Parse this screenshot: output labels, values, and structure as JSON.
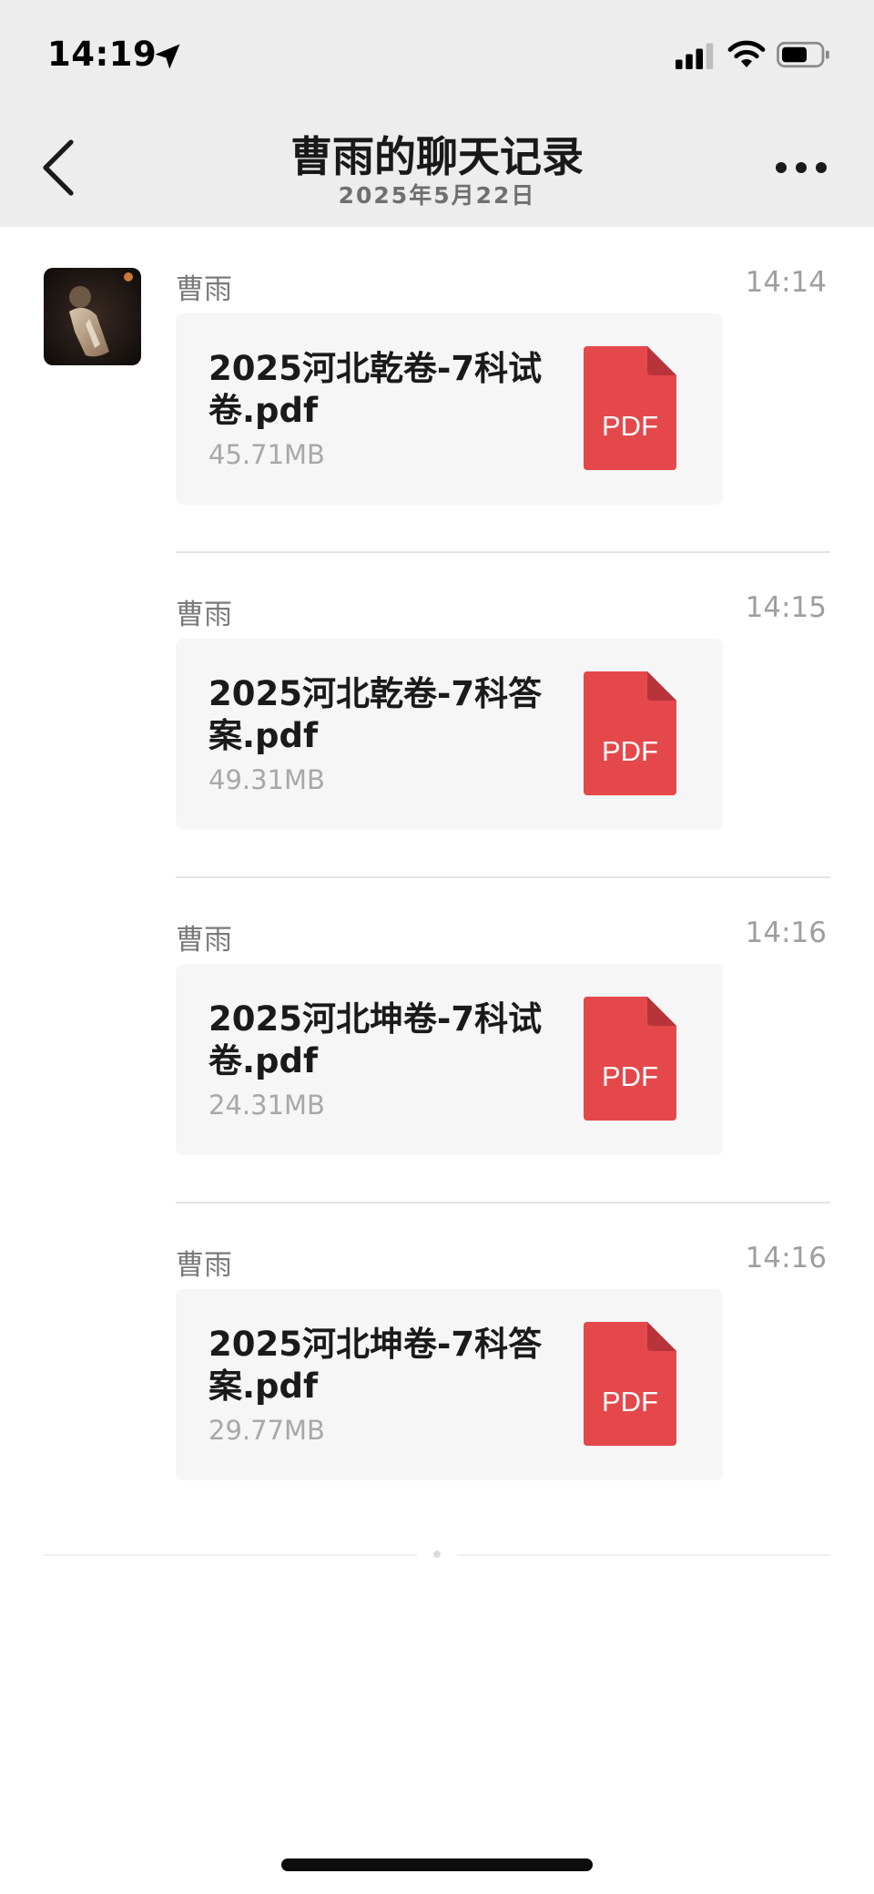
{
  "status_bar": {
    "time": "14:19",
    "icons": [
      "location-arrow-icon",
      "cellular-signal-icon",
      "wifi-icon",
      "battery-icon"
    ]
  },
  "nav": {
    "back_icon": "chevron-left-icon",
    "title": "曹雨的聊天记录",
    "subtitle": "2025年5月22日",
    "more_icon": "more-dots-icon"
  },
  "records": [
    {
      "sender": "曹雨",
      "time": "14:14",
      "file_name": "2025河北乾卷-7科试卷.pdf",
      "file_size": "45.71MB",
      "icon_label": "PDF"
    },
    {
      "sender": "曹雨",
      "time": "14:15",
      "file_name": "2025河北乾卷-7科答案.pdf",
      "file_size": "49.31MB",
      "icon_label": "PDF"
    },
    {
      "sender": "曹雨",
      "time": "14:16",
      "file_name": "2025河北坤卷-7科试卷.pdf",
      "file_size": "24.31MB",
      "icon_label": "PDF"
    },
    {
      "sender": "曹雨",
      "time": "14:16",
      "file_name": "2025河北坤卷-7科答案.pdf",
      "file_size": "29.77MB",
      "icon_label": "PDF"
    }
  ],
  "colors": {
    "header_bg": "#ededed",
    "pdf_red": "#e4484b",
    "pdf_fold": "#b8343a",
    "card_bg": "#f6f6f6"
  }
}
